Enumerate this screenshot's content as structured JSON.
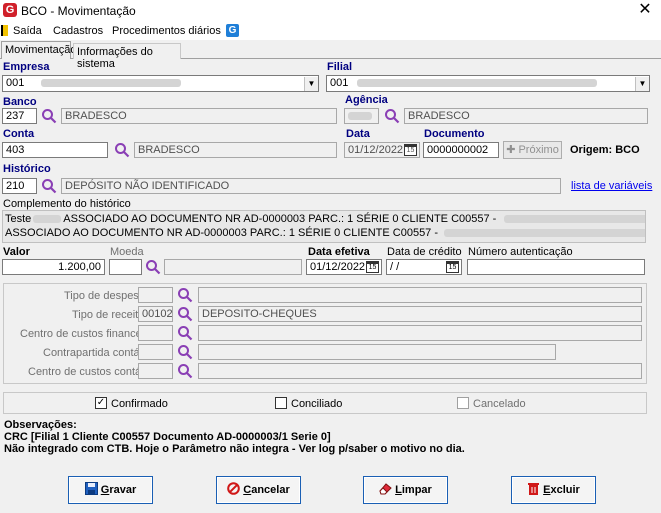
{
  "window": {
    "title": "BCO - Movimentação",
    "app_icon_letter": "G"
  },
  "menu": {
    "items": [
      "Saída",
      "Cadastros",
      "Procedimentos diários"
    ],
    "help_icon_letter": "G"
  },
  "tabs": [
    "Movimentação",
    "Informações do sistema"
  ],
  "form": {
    "empresa_label": "Empresa",
    "empresa_value": "001",
    "filial_label": "Filial",
    "filial_value": "001",
    "banco_label": "Banco",
    "banco_code": "237",
    "banco_name": "BRADESCO",
    "agencia_label": "Agência",
    "agencia_name": "BRADESCO",
    "conta_label": "Conta",
    "conta_code": "403",
    "conta_name": "BRADESCO",
    "data_label": "Data",
    "data_value": "01/12/2022",
    "documento_label": "Documento",
    "documento_value": "0000000002",
    "proximo_label": "Próximo",
    "origem_text": "Origem: BCO",
    "historico_label": "Histórico",
    "historico_code": "210",
    "historico_desc": "DEPÓSITO NÃO IDENTIFICADO",
    "variaveis_link": "lista de variáveis",
    "complemento_label": "Complemento do histórico",
    "complemento_line1_a": "Teste",
    "complemento_line1_b": "ASSOCIADO AO DOCUMENTO NR AD-0000003 PARC.: 1 SÉRIE 0 CLIENTE C00557 -",
    "complemento_line2": "ASSOCIADO AO DOCUMENTO NR AD-0000003 PARC.: 1 SÉRIE 0 CLIENTE C00557 -",
    "valor_label": "Valor",
    "valor_value": "1.200,00",
    "moeda_label": "Moeda",
    "data_efetiva_label": "Data efetiva",
    "data_efetiva_value": "01/12/2022",
    "data_credito_label": "Data de crédito",
    "data_credito_value": " / /",
    "numero_aut_label": "Número autenticação"
  },
  "details": {
    "tipo_despesa_label": "Tipo de despesa",
    "tipo_receita_label": "Tipo de receita",
    "tipo_receita_code": "00102",
    "tipo_receita_desc": "DEPOSITO-CHEQUES",
    "ccusto_fin_label": "Centro de custos financeiro",
    "contrapartida_label": "Contrapartida contábil",
    "ccusto_cont_label": "Centro de custos contábil"
  },
  "status": {
    "confirmado_label": "Confirmado",
    "confirmado_checked": true,
    "conciliado_label": "Conciliado",
    "conciliado_checked": false,
    "cancelado_label": "Cancelado",
    "cancelado_checked": false
  },
  "observacoes": {
    "title": "Observações:",
    "line1": "CRC [Filial 1 Cliente C00557 Documento AD-0000003/1 Serie 0]",
    "line2": "Não integrado com CTB.  Hoje o Parâmetro não integra - Ver log p/saber o motivo no dia."
  },
  "buttons": {
    "gravar_u": "G",
    "gravar_rest": "ravar",
    "cancelar_u": "C",
    "cancelar_rest": "ancelar",
    "limpar_u": "L",
    "limpar_rest": "impar",
    "excluir_u": "E",
    "excluir_rest": "xcluir"
  },
  "colors": {
    "label_blue": "#000080",
    "button_border": "#1a5fb4",
    "search_icon": "#8a3fb5"
  }
}
